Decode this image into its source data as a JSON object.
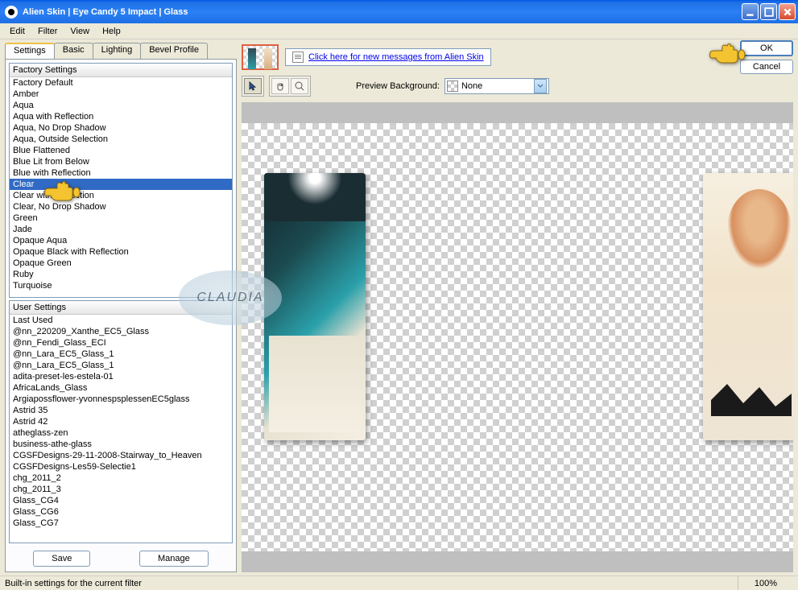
{
  "window": {
    "title": "Alien Skin  |  Eye Candy 5 Impact  |  Glass"
  },
  "menu": {
    "edit": "Edit",
    "filter": "Filter",
    "view": "View",
    "help": "Help"
  },
  "tabs": {
    "settings": "Settings",
    "basic": "Basic",
    "lighting": "Lighting",
    "bevel": "Bevel Profile"
  },
  "factory": {
    "header": "Factory Settings",
    "items": [
      "Factory Default",
      "Amber",
      "Aqua",
      "Aqua with Reflection",
      "Aqua, No Drop Shadow",
      "Aqua, Outside Selection",
      "Blue Flattened",
      "Blue Lit from Below",
      "Blue with Reflection",
      "Clear",
      "Clear with Reflection",
      "Clear, No Drop Shadow",
      "Green",
      "Jade",
      "Opaque Aqua",
      "Opaque Black with Reflection",
      "Opaque Green",
      "Ruby",
      "Turquoise"
    ],
    "selectedIndex": 9
  },
  "user": {
    "header": "User Settings",
    "items": [
      "Last Used",
      "@nn_220209_Xanthe_EC5_Glass",
      "@nn_Fendi_Glass_ECI",
      "@nn_Lara_EC5_Glass_1",
      "@nn_Lara_EC5_Glass_1",
      "adita-preset-les-estela-01",
      "AfricaLands_Glass",
      "Argiapossflower-yvonnespsplessenEC5glass",
      "Astrid 35",
      "Astrid 42",
      "atheglass-zen",
      "business-athe-glass",
      "CGSFDesigns-29-11-2008-Stairway_to_Heaven",
      "CGSFDesigns-Les59-Selectie1",
      "chg_2011_2",
      "chg_2011_3",
      "Glass_CG4",
      "Glass_CG6",
      "Glass_CG7"
    ]
  },
  "buttons": {
    "save": "Save",
    "manage": "Manage",
    "ok": "OK",
    "cancel": "Cancel"
  },
  "message": {
    "text": "Click here for new messages from Alien Skin"
  },
  "preview": {
    "label": "Preview Background:",
    "value": "None"
  },
  "status": {
    "text": "Built-in settings for the current filter",
    "zoom": "100%"
  },
  "watermark": "CLAUDIA"
}
